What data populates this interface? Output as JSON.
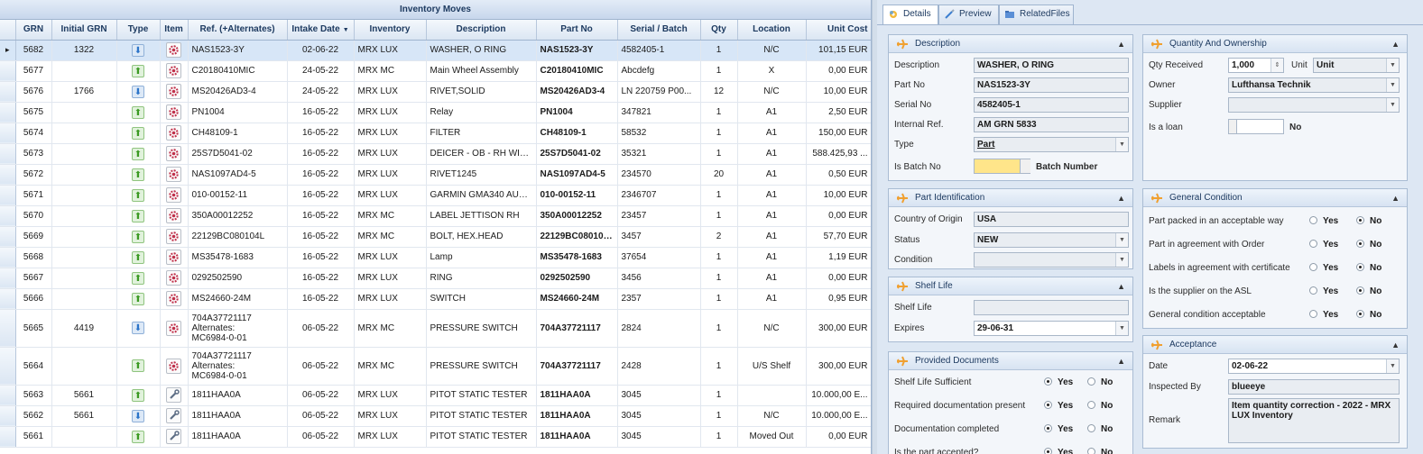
{
  "grid": {
    "title": "Inventory Moves",
    "columns": [
      "GRN",
      "Initial GRN",
      "Type",
      "Item",
      "Ref. (+Alternates)",
      "Intake Date",
      "Inventory",
      "Description",
      "Part No",
      "Serial / Batch",
      "Qty",
      "Location",
      "Unit Cost"
    ],
    "sort_indicator": "▼",
    "row_indicator": "▸",
    "rows": [
      {
        "grn": "5682",
        "initial": "1322",
        "type": "down",
        "item": "gear",
        "ref": "NAS1523-3Y",
        "date": "02-06-22",
        "inv": "MRX LUX",
        "desc": "WASHER, O RING",
        "part": "NAS1523-3Y",
        "serial": "4582405-1",
        "qty": "1",
        "loc": "N/C",
        "cost": "101,15 EUR",
        "extra": "",
        "selected": true
      },
      {
        "grn": "5677",
        "initial": "",
        "type": "up",
        "item": "gear",
        "ref": "C20180410MIC",
        "date": "24-05-22",
        "inv": "MRX MC",
        "desc": "Main Wheel Assembly",
        "part": "C20180410MIC",
        "serial": "Abcdefg",
        "qty": "1",
        "loc": "X",
        "cost": "0,00 EUR",
        "extra": ""
      },
      {
        "grn": "5676",
        "initial": "1766",
        "type": "down",
        "item": "gear",
        "ref": "MS20426AD3-4",
        "date": "24-05-22",
        "inv": "MRX LUX",
        "desc": "RIVET,SOLID",
        "part": "MS20426AD3-4",
        "serial": "LN 220759 P00...",
        "qty": "12",
        "loc": "N/C",
        "cost": "10,00 EUR",
        "extra": ""
      },
      {
        "grn": "5675",
        "initial": "",
        "type": "up",
        "item": "gear",
        "ref": "PN1004",
        "date": "16-05-22",
        "inv": "MRX LUX",
        "desc": "Relay",
        "part": "PN1004",
        "serial": "347821",
        "qty": "1",
        "loc": "A1",
        "cost": "2,50 EUR",
        "extra": ""
      },
      {
        "grn": "5674",
        "initial": "",
        "type": "up",
        "item": "gear",
        "ref": "CH48109-1",
        "date": "16-05-22",
        "inv": "MRX LUX",
        "desc": "FILTER",
        "part": "CH48109-1",
        "serial": "58532",
        "qty": "1",
        "loc": "A1",
        "cost": "150,00 EUR",
        "extra": "4"
      },
      {
        "grn": "5673",
        "initial": "",
        "type": "up",
        "item": "gear",
        "ref": "25S7D5041-02",
        "date": "16-05-22",
        "inv": "MRX LUX",
        "desc": "DEICER - OB - RH WING",
        "part": "25S7D5041-02",
        "serial": "35321",
        "qty": "1",
        "loc": "A1",
        "cost": "588.425,93 ...",
        "extra": "4"
      },
      {
        "grn": "5672",
        "initial": "",
        "type": "up",
        "item": "gear",
        "ref": "NAS1097AD4-5",
        "date": "16-05-22",
        "inv": "MRX LUX",
        "desc": "RIVET1245",
        "part": "NAS1097AD4-5",
        "serial": "234570",
        "qty": "20",
        "loc": "A1",
        "cost": "0,50 EUR",
        "extra": ""
      },
      {
        "grn": "5671",
        "initial": "",
        "type": "up",
        "item": "gear",
        "ref": "010-00152-11",
        "date": "16-05-22",
        "inv": "MRX LUX",
        "desc": "GARMIN GMA340 AUD...",
        "part": "010-00152-11",
        "serial": "2346707",
        "qty": "1",
        "loc": "A1",
        "cost": "10,00 EUR",
        "extra": "2"
      },
      {
        "grn": "5670",
        "initial": "",
        "type": "up",
        "item": "gear",
        "ref": "350A00012252",
        "date": "16-05-22",
        "inv": "MRX MC",
        "desc": "LABEL JETTISON RH",
        "part": "350A00012252",
        "serial": "23457",
        "qty": "1",
        "loc": "A1",
        "cost": "0,00 EUR",
        "extra": ""
      },
      {
        "grn": "5669",
        "initial": "",
        "type": "up",
        "item": "gear",
        "ref": "22129BC080104L",
        "date": "16-05-22",
        "inv": "MRX MC",
        "desc": "BOLT, HEX.HEAD",
        "part": "22129BC080104L",
        "serial": "3457",
        "qty": "2",
        "loc": "A1",
        "cost": "57,70 EUR",
        "extra": ""
      },
      {
        "grn": "5668",
        "initial": "",
        "type": "up",
        "item": "gear",
        "ref": " MS35478-1683",
        "date": "16-05-22",
        "inv": "MRX LUX",
        "desc": "Lamp",
        "part": " MS35478-1683",
        "serial": "37654",
        "qty": "1",
        "loc": "A1",
        "cost": "1,19 EUR",
        "extra": ""
      },
      {
        "grn": "5667",
        "initial": "",
        "type": "up",
        "item": "gear",
        "ref": "0292502590",
        "date": "16-05-22",
        "inv": "MRX LUX",
        "desc": "RING",
        "part": "0292502590",
        "serial": "3456",
        "qty": "1",
        "loc": "A1",
        "cost": "0,00 EUR",
        "extra": "2"
      },
      {
        "grn": "5666",
        "initial": "",
        "type": "up",
        "item": "gear",
        "ref": "MS24660-24M",
        "date": "16-05-22",
        "inv": "MRX LUX",
        "desc": "SWITCH",
        "part": "MS24660-24M",
        "serial": "2357",
        "qty": "1",
        "loc": "A1",
        "cost": "0,95 EUR",
        "extra": ""
      },
      {
        "grn": "5665",
        "initial": "4419",
        "type": "down",
        "item": "gear",
        "ref": "704A37721117\nAlternates:\nMC6984-0-01",
        "date": "06-05-22",
        "inv": "MRX MC",
        "desc": "PRESSURE SWITCH",
        "part": "704A37721117",
        "serial": "2824",
        "qty": "1",
        "loc": "N/C",
        "cost": "300,00 EUR",
        "extra": "",
        "tall": true
      },
      {
        "grn": "5664",
        "initial": "",
        "type": "up",
        "item": "gear",
        "ref": "704A37721117\nAlternates:\nMC6984-0-01",
        "date": "06-05-22",
        "inv": "MRX MC",
        "desc": "PRESSURE SWITCH",
        "part": "704A37721117",
        "serial": "2428",
        "qty": "1",
        "loc": "U/S Shelf",
        "cost": "300,00 EUR",
        "extra": "2",
        "tall": true
      },
      {
        "grn": "5663",
        "initial": "5661",
        "type": "up",
        "item": "tool",
        "ref": "1811HAA0A",
        "date": "06-05-22",
        "inv": "MRX LUX",
        "desc": "PITOT STATIC TESTER",
        "part": "1811HAA0A",
        "serial": "3045",
        "qty": "1",
        "loc": "",
        "cost": "10.000,00 E...",
        "extra": ""
      },
      {
        "grn": "5662",
        "initial": "5661",
        "type": "down",
        "item": "tool",
        "ref": "1811HAA0A",
        "date": "06-05-22",
        "inv": "MRX LUX",
        "desc": "PITOT STATIC TESTER",
        "part": "1811HAA0A",
        "serial": "3045",
        "qty": "1",
        "loc": "N/C",
        "cost": "10.000,00 E...",
        "extra": ""
      },
      {
        "grn": "5661",
        "initial": "",
        "type": "up",
        "item": "tool",
        "ref": "1811HAA0A",
        "date": "06-05-22",
        "inv": "MRX LUX",
        "desc": "PITOT STATIC TESTER",
        "part": "1811HAA0A",
        "serial": "3045",
        "qty": "1",
        "loc": "Moved Out",
        "cost": "0,00 EUR",
        "extra": ""
      }
    ]
  },
  "tabs": [
    {
      "label": "Details",
      "icon": "gear-colored-icon",
      "active": true
    },
    {
      "label": "Preview",
      "icon": "preview-icon",
      "active": false
    },
    {
      "label": "RelatedFiles",
      "icon": "files-icon",
      "active": false
    }
  ],
  "description_panel": {
    "title": "Description",
    "description_label": "Description",
    "description": "WASHER, O RING",
    "part_no_label": "Part No",
    "part_no": "NAS1523-3Y",
    "serial_no_label": "Serial No",
    "serial_no": "4582405-1",
    "internal_ref_label": "Internal Ref.",
    "internal_ref": "AM GRN 5833",
    "type_label": "Type",
    "type": "Part",
    "batch_label": "Is Batch No",
    "batch_text": "Batch Number"
  },
  "quantity_panel": {
    "title": "Quantity And Ownership",
    "qty_label": "Qty Received",
    "qty": "1,000",
    "unit_label": "Unit",
    "unit": "Unit",
    "owner_label": "Owner",
    "owner": "Lufthansa Technik",
    "supplier_label": "Supplier",
    "supplier": "",
    "loan_label": "Is a loan",
    "loan_text": "No"
  },
  "part_id_panel": {
    "title": "Part Identification",
    "country_label": "Country of Origin",
    "country": "USA",
    "status_label": "Status",
    "status": "NEW",
    "condition_label": "Condition",
    "condition": ""
  },
  "general_condition_panel": {
    "title": "General Condition",
    "yes": "Yes",
    "no": "No",
    "items": [
      "Part packed in an acceptable way",
      "Part in agreement with Order",
      "Labels in agreement with certificate",
      "Is the supplier on the ASL",
      "General condition acceptable"
    ]
  },
  "shelf_life_panel": {
    "title": "Shelf Life",
    "shelf_life_label": "Shelf Life",
    "shelf_life": "",
    "expires_label": "Expires",
    "expires": "29-06-31"
  },
  "acceptance_panel": {
    "title": "Acceptance",
    "date_label": "Date",
    "date": "02-06-22",
    "inspected_label": "Inspected By",
    "inspected": "blueeye",
    "remark_label": "Remark",
    "remark": "Item quantity correction - 2022 - MRX LUX Inventory"
  },
  "documents_panel": {
    "title": "Provided Documents",
    "yes": "Yes",
    "no": "No",
    "items": [
      "Shelf Life Sufficient",
      "Required documentation present",
      "Documentation completed",
      "Is the part accepted?"
    ]
  },
  "colors": {
    "accent": "#f0a030",
    "selection": "#d7e6f7",
    "header": "#c7d7ec"
  }
}
